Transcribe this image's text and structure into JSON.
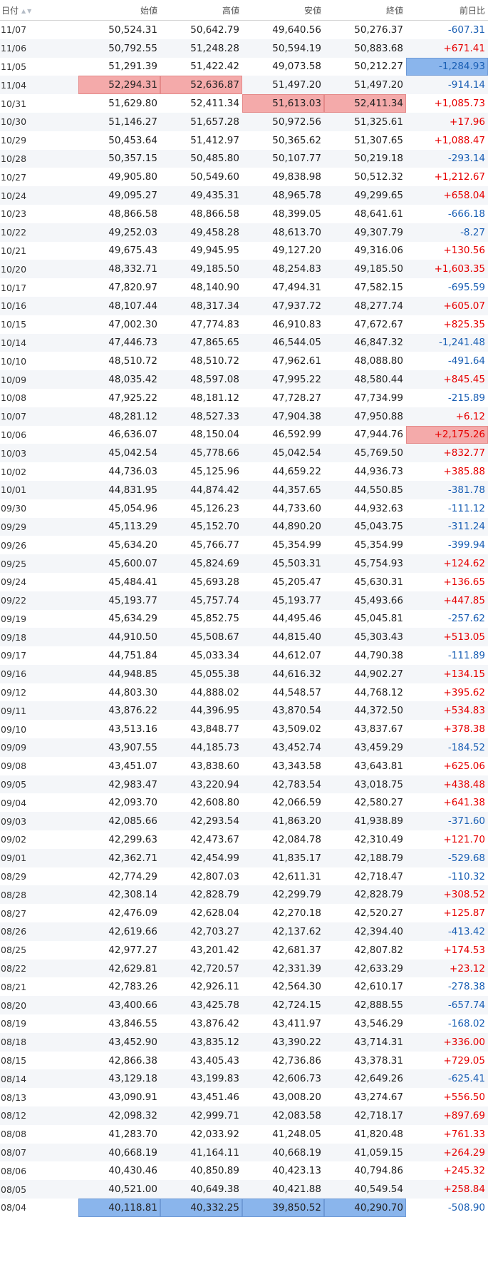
{
  "headers": {
    "date": "日付",
    "open": "始値",
    "high": "高値",
    "low": "安値",
    "close": "終値",
    "change": "前日比"
  },
  "sort_icon": "sort-up-down-icon",
  "colors": {
    "positive": "#e60000",
    "negative": "#1a5fb4",
    "highlight_max": "#f4aaaa",
    "highlight_min": "#8ab5ec"
  },
  "rows": [
    {
      "date": "11/07",
      "open": "50,524.31",
      "high": "50,642.79",
      "low": "49,640.56",
      "close": "50,276.37",
      "change": "-607.31"
    },
    {
      "date": "11/06",
      "open": "50,792.55",
      "high": "51,248.28",
      "low": "50,594.19",
      "close": "50,883.68",
      "change": "+671.41"
    },
    {
      "date": "11/05",
      "open": "51,291.39",
      "high": "51,422.42",
      "low": "49,073.58",
      "close": "50,212.27",
      "change": "-1,284.93",
      "hl": {
        "change": "min"
      }
    },
    {
      "date": "11/04",
      "open": "52,294.31",
      "high": "52,636.87",
      "low": "51,497.20",
      "close": "51,497.20",
      "change": "-914.14",
      "hl": {
        "open": "max",
        "high": "max"
      }
    },
    {
      "date": "10/31",
      "open": "51,629.80",
      "high": "52,411.34",
      "low": "51,613.03",
      "close": "52,411.34",
      "change": "+1,085.73",
      "hl": {
        "low": "max",
        "close": "max"
      }
    },
    {
      "date": "10/30",
      "open": "51,146.27",
      "high": "51,657.28",
      "low": "50,972.56",
      "close": "51,325.61",
      "change": "+17.96"
    },
    {
      "date": "10/29",
      "open": "50,453.64",
      "high": "51,412.97",
      "low": "50,365.62",
      "close": "51,307.65",
      "change": "+1,088.47"
    },
    {
      "date": "10/28",
      "open": "50,357.15",
      "high": "50,485.80",
      "low": "50,107.77",
      "close": "50,219.18",
      "change": "-293.14"
    },
    {
      "date": "10/27",
      "open": "49,905.80",
      "high": "50,549.60",
      "low": "49,838.98",
      "close": "50,512.32",
      "change": "+1,212.67"
    },
    {
      "date": "10/24",
      "open": "49,095.27",
      "high": "49,435.31",
      "low": "48,965.78",
      "close": "49,299.65",
      "change": "+658.04"
    },
    {
      "date": "10/23",
      "open": "48,866.58",
      "high": "48,866.58",
      "low": "48,399.05",
      "close": "48,641.61",
      "change": "-666.18"
    },
    {
      "date": "10/22",
      "open": "49,252.03",
      "high": "49,458.28",
      "low": "48,613.70",
      "close": "49,307.79",
      "change": "-8.27"
    },
    {
      "date": "10/21",
      "open": "49,675.43",
      "high": "49,945.95",
      "low": "49,127.20",
      "close": "49,316.06",
      "change": "+130.56"
    },
    {
      "date": "10/20",
      "open": "48,332.71",
      "high": "49,185.50",
      "low": "48,254.83",
      "close": "49,185.50",
      "change": "+1,603.35"
    },
    {
      "date": "10/17",
      "open": "47,820.97",
      "high": "48,140.90",
      "low": "47,494.31",
      "close": "47,582.15",
      "change": "-695.59"
    },
    {
      "date": "10/16",
      "open": "48,107.44",
      "high": "48,317.34",
      "low": "47,937.72",
      "close": "48,277.74",
      "change": "+605.07"
    },
    {
      "date": "10/15",
      "open": "47,002.30",
      "high": "47,774.83",
      "low": "46,910.83",
      "close": "47,672.67",
      "change": "+825.35"
    },
    {
      "date": "10/14",
      "open": "47,446.73",
      "high": "47,865.65",
      "low": "46,544.05",
      "close": "46,847.32",
      "change": "-1,241.48"
    },
    {
      "date": "10/10",
      "open": "48,510.72",
      "high": "48,510.72",
      "low": "47,962.61",
      "close": "48,088.80",
      "change": "-491.64"
    },
    {
      "date": "10/09",
      "open": "48,035.42",
      "high": "48,597.08",
      "low": "47,995.22",
      "close": "48,580.44",
      "change": "+845.45"
    },
    {
      "date": "10/08",
      "open": "47,925.22",
      "high": "48,181.12",
      "low": "47,728.27",
      "close": "47,734.99",
      "change": "-215.89"
    },
    {
      "date": "10/07",
      "open": "48,281.12",
      "high": "48,527.33",
      "low": "47,904.38",
      "close": "47,950.88",
      "change": "+6.12"
    },
    {
      "date": "10/06",
      "open": "46,636.07",
      "high": "48,150.04",
      "low": "46,592.99",
      "close": "47,944.76",
      "change": "+2,175.26",
      "hl": {
        "change": "max"
      }
    },
    {
      "date": "10/03",
      "open": "45,042.54",
      "high": "45,778.66",
      "low": "45,042.54",
      "close": "45,769.50",
      "change": "+832.77"
    },
    {
      "date": "10/02",
      "open": "44,736.03",
      "high": "45,125.96",
      "low": "44,659.22",
      "close": "44,936.73",
      "change": "+385.88"
    },
    {
      "date": "10/01",
      "open": "44,831.95",
      "high": "44,874.42",
      "low": "44,357.65",
      "close": "44,550.85",
      "change": "-381.78"
    },
    {
      "date": "09/30",
      "open": "45,054.96",
      "high": "45,126.23",
      "low": "44,733.60",
      "close": "44,932.63",
      "change": "-111.12"
    },
    {
      "date": "09/29",
      "open": "45,113.29",
      "high": "45,152.70",
      "low": "44,890.20",
      "close": "45,043.75",
      "change": "-311.24"
    },
    {
      "date": "09/26",
      "open": "45,634.20",
      "high": "45,766.77",
      "low": "45,354.99",
      "close": "45,354.99",
      "change": "-399.94"
    },
    {
      "date": "09/25",
      "open": "45,600.07",
      "high": "45,824.69",
      "low": "45,503.31",
      "close": "45,754.93",
      "change": "+124.62"
    },
    {
      "date": "09/24",
      "open": "45,484.41",
      "high": "45,693.28",
      "low": "45,205.47",
      "close": "45,630.31",
      "change": "+136.65"
    },
    {
      "date": "09/22",
      "open": "45,193.77",
      "high": "45,757.74",
      "low": "45,193.77",
      "close": "45,493.66",
      "change": "+447.85"
    },
    {
      "date": "09/19",
      "open": "45,634.29",
      "high": "45,852.75",
      "low": "44,495.46",
      "close": "45,045.81",
      "change": "-257.62"
    },
    {
      "date": "09/18",
      "open": "44,910.50",
      "high": "45,508.67",
      "low": "44,815.40",
      "close": "45,303.43",
      "change": "+513.05"
    },
    {
      "date": "09/17",
      "open": "44,751.84",
      "high": "45,033.34",
      "low": "44,612.07",
      "close": "44,790.38",
      "change": "-111.89"
    },
    {
      "date": "09/16",
      "open": "44,948.85",
      "high": "45,055.38",
      "low": "44,616.32",
      "close": "44,902.27",
      "change": "+134.15"
    },
    {
      "date": "09/12",
      "open": "44,803.30",
      "high": "44,888.02",
      "low": "44,548.57",
      "close": "44,768.12",
      "change": "+395.62"
    },
    {
      "date": "09/11",
      "open": "43,876.22",
      "high": "44,396.95",
      "low": "43,870.54",
      "close": "44,372.50",
      "change": "+534.83"
    },
    {
      "date": "09/10",
      "open": "43,513.16",
      "high": "43,848.77",
      "low": "43,509.02",
      "close": "43,837.67",
      "change": "+378.38"
    },
    {
      "date": "09/09",
      "open": "43,907.55",
      "high": "44,185.73",
      "low": "43,452.74",
      "close": "43,459.29",
      "change": "-184.52"
    },
    {
      "date": "09/08",
      "open": "43,451.07",
      "high": "43,838.60",
      "low": "43,343.58",
      "close": "43,643.81",
      "change": "+625.06"
    },
    {
      "date": "09/05",
      "open": "42,983.47",
      "high": "43,220.94",
      "low": "42,783.54",
      "close": "43,018.75",
      "change": "+438.48"
    },
    {
      "date": "09/04",
      "open": "42,093.70",
      "high": "42,608.80",
      "low": "42,066.59",
      "close": "42,580.27",
      "change": "+641.38"
    },
    {
      "date": "09/03",
      "open": "42,085.66",
      "high": "42,293.54",
      "low": "41,863.20",
      "close": "41,938.89",
      "change": "-371.60"
    },
    {
      "date": "09/02",
      "open": "42,299.63",
      "high": "42,473.67",
      "low": "42,084.78",
      "close": "42,310.49",
      "change": "+121.70"
    },
    {
      "date": "09/01",
      "open": "42,362.71",
      "high": "42,454.99",
      "low": "41,835.17",
      "close": "42,188.79",
      "change": "-529.68"
    },
    {
      "date": "08/29",
      "open": "42,774.29",
      "high": "42,807.03",
      "low": "42,611.31",
      "close": "42,718.47",
      "change": "-110.32"
    },
    {
      "date": "08/28",
      "open": "42,308.14",
      "high": "42,828.79",
      "low": "42,299.79",
      "close": "42,828.79",
      "change": "+308.52"
    },
    {
      "date": "08/27",
      "open": "42,476.09",
      "high": "42,628.04",
      "low": "42,270.18",
      "close": "42,520.27",
      "change": "+125.87"
    },
    {
      "date": "08/26",
      "open": "42,619.66",
      "high": "42,703.27",
      "low": "42,137.62",
      "close": "42,394.40",
      "change": "-413.42"
    },
    {
      "date": "08/25",
      "open": "42,977.27",
      "high": "43,201.42",
      "low": "42,681.37",
      "close": "42,807.82",
      "change": "+174.53"
    },
    {
      "date": "08/22",
      "open": "42,629.81",
      "high": "42,720.57",
      "low": "42,331.39",
      "close": "42,633.29",
      "change": "+23.12"
    },
    {
      "date": "08/21",
      "open": "42,783.26",
      "high": "42,926.11",
      "low": "42,564.30",
      "close": "42,610.17",
      "change": "-278.38"
    },
    {
      "date": "08/20",
      "open": "43,400.66",
      "high": "43,425.78",
      "low": "42,724.15",
      "close": "42,888.55",
      "change": "-657.74"
    },
    {
      "date": "08/19",
      "open": "43,846.55",
      "high": "43,876.42",
      "low": "43,411.97",
      "close": "43,546.29",
      "change": "-168.02"
    },
    {
      "date": "08/18",
      "open": "43,452.90",
      "high": "43,835.12",
      "low": "43,390.22",
      "close": "43,714.31",
      "change": "+336.00"
    },
    {
      "date": "08/15",
      "open": "42,866.38",
      "high": "43,405.43",
      "low": "42,736.86",
      "close": "43,378.31",
      "change": "+729.05"
    },
    {
      "date": "08/14",
      "open": "43,129.18",
      "high": "43,199.83",
      "low": "42,606.73",
      "close": "42,649.26",
      "change": "-625.41"
    },
    {
      "date": "08/13",
      "open": "43,090.91",
      "high": "43,451.46",
      "low": "43,008.20",
      "close": "43,274.67",
      "change": "+556.50"
    },
    {
      "date": "08/12",
      "open": "42,098.32",
      "high": "42,999.71",
      "low": "42,083.58",
      "close": "42,718.17",
      "change": "+897.69"
    },
    {
      "date": "08/08",
      "open": "41,283.70",
      "high": "42,033.92",
      "low": "41,248.05",
      "close": "41,820.48",
      "change": "+761.33"
    },
    {
      "date": "08/07",
      "open": "40,668.19",
      "high": "41,164.11",
      "low": "40,668.19",
      "close": "41,059.15",
      "change": "+264.29"
    },
    {
      "date": "08/06",
      "open": "40,430.46",
      "high": "40,850.89",
      "low": "40,423.13",
      "close": "40,794.86",
      "change": "+245.32"
    },
    {
      "date": "08/05",
      "open": "40,521.00",
      "high": "40,649.38",
      "low": "40,421.88",
      "close": "40,549.54",
      "change": "+258.84"
    },
    {
      "date": "08/04",
      "open": "40,118.81",
      "high": "40,332.25",
      "low": "39,850.52",
      "close": "40,290.70",
      "change": "-508.90",
      "hl": {
        "open": "min",
        "high": "min",
        "low": "min",
        "close": "min"
      }
    }
  ]
}
